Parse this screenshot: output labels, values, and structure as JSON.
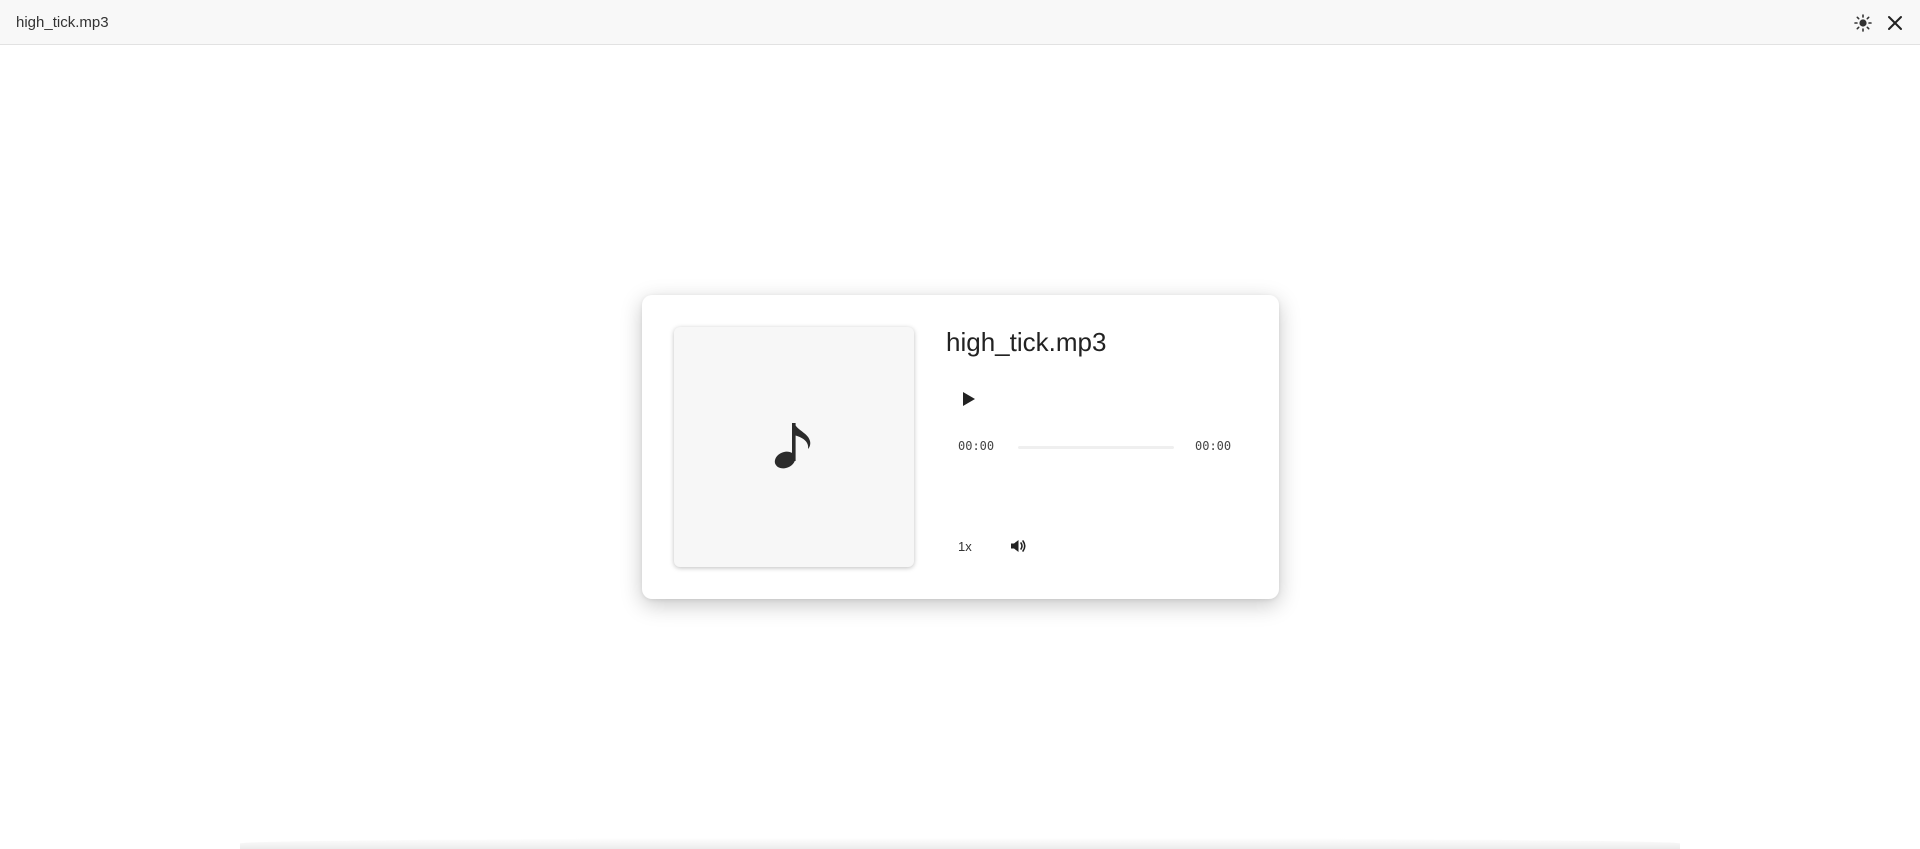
{
  "window": {
    "title": "high_tick.mp3"
  },
  "titlebar": {
    "theme_icon": "sun-icon",
    "close_icon": "close-icon"
  },
  "player": {
    "cover_icon": "music-note-icon",
    "track_title": "high_tick.mp3",
    "play_icon": "play-icon",
    "current_time": "00:00",
    "total_time": "00:00",
    "progress": 0,
    "speed_label": "1x",
    "volume_icon": "volume-icon"
  }
}
